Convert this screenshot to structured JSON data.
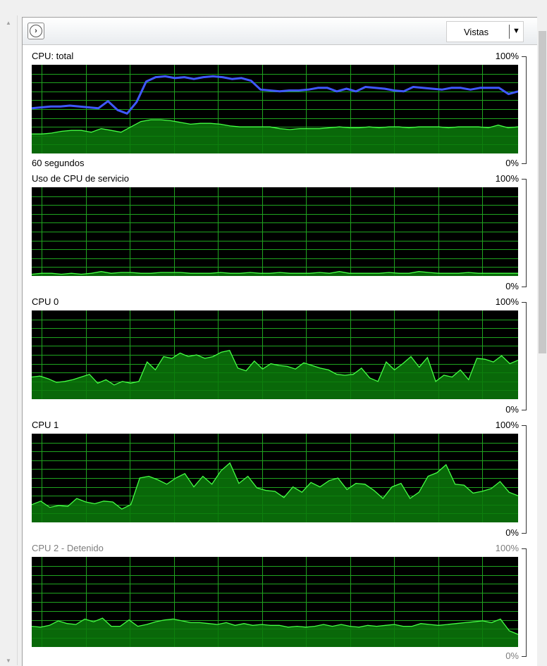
{
  "toolbar": {
    "views_label": "Vistas",
    "expand_icon": "chevron-right-icon"
  },
  "colors": {
    "grid": "#1fa31f",
    "fill": "#0a7a0a",
    "line": "#44ff44",
    "total_line": "#3f58ff",
    "background": "#000000"
  },
  "graphs": [
    {
      "id": "total",
      "title": "CPU: total",
      "max_label": "100%",
      "min_label": "0%",
      "duration_label": "60 segundos",
      "stopped": false
    },
    {
      "id": "service",
      "title": "Uso de CPU de servicio",
      "max_label": "100%",
      "min_label": "0%",
      "stopped": false
    },
    {
      "id": "cpu0",
      "title": "CPU 0",
      "max_label": "100%",
      "min_label": "0%",
      "stopped": false
    },
    {
      "id": "cpu1",
      "title": "CPU 1",
      "max_label": "100%",
      "min_label": "0%",
      "stopped": false
    },
    {
      "id": "cpu2",
      "title": "CPU 2 - Detenido",
      "max_label": "100%",
      "min_label": "0%",
      "stopped": true
    }
  ],
  "chart_data": [
    {
      "type": "area",
      "title": "CPU: total",
      "ylim": [
        0,
        100
      ],
      "series": [
        {
          "values": [
            22,
            22,
            23,
            25,
            26,
            26,
            24,
            28,
            26,
            24,
            30,
            36,
            38,
            38,
            37,
            35,
            33,
            34,
            34,
            33,
            31,
            30,
            30,
            30,
            30,
            28,
            27,
            28,
            28,
            28,
            29,
            30,
            29,
            29,
            30,
            29,
            30,
            30,
            29,
            30,
            30,
            30,
            29,
            30,
            30,
            30,
            29,
            32,
            29,
            30
          ]
        },
        {
          "values": [
            51,
            52,
            53,
            53,
            54,
            53,
            52,
            51,
            59,
            49,
            45,
            58,
            81,
            86,
            87,
            85,
            86,
            84,
            86,
            87,
            86,
            84,
            85,
            82,
            72,
            71,
            70,
            71,
            71,
            72,
            74,
            74,
            70,
            73,
            70,
            75,
            74,
            73,
            71,
            70,
            75,
            74,
            73,
            72,
            74,
            74,
            72,
            74,
            74,
            74,
            67,
            70
          ]
        }
      ],
      "grid": true
    },
    {
      "type": "area",
      "title": "Uso de CPU de servicio",
      "ylim": [
        0,
        100
      ],
      "series": [
        {
          "values": [
            2,
            3,
            3,
            2,
            3,
            2,
            3,
            5,
            3,
            4,
            4,
            3,
            3,
            4,
            4,
            4,
            3,
            3,
            3,
            4,
            3,
            3,
            4,
            3,
            3,
            4,
            3,
            3,
            3,
            4,
            3,
            5,
            3,
            3,
            3,
            3,
            4,
            3,
            3,
            5,
            4,
            3,
            3,
            3,
            4,
            3,
            3,
            3,
            3,
            3
          ]
        }
      ],
      "grid": true
    },
    {
      "type": "area",
      "title": "CPU 0",
      "ylim": [
        0,
        100
      ],
      "series": [
        {
          "values": [
            25,
            26,
            23,
            19,
            20,
            22,
            25,
            28,
            18,
            22,
            16,
            20,
            18,
            20,
            42,
            33,
            48,
            46,
            52,
            48,
            50,
            46,
            48,
            53,
            55,
            35,
            32,
            43,
            34,
            40,
            38,
            37,
            34,
            41,
            38,
            35,
            33,
            28,
            27,
            28,
            35,
            24,
            20,
            42,
            33,
            40,
            48,
            36,
            47,
            20,
            27,
            25,
            33,
            22,
            46,
            45,
            42,
            49,
            40,
            44
          ]
        }
      ],
      "grid": true
    },
    {
      "type": "area",
      "title": "CPU 1",
      "ylim": [
        0,
        100
      ],
      "series": [
        {
          "values": [
            20,
            24,
            17,
            19,
            18,
            27,
            23,
            21,
            24,
            23,
            15,
            20,
            50,
            52,
            48,
            43,
            50,
            55,
            40,
            52,
            43,
            58,
            67,
            44,
            52,
            39,
            36,
            35,
            28,
            40,
            34,
            45,
            40,
            47,
            50,
            37,
            44,
            43,
            36,
            27,
            40,
            44,
            27,
            34,
            52,
            56,
            65,
            43,
            42,
            33,
            35,
            38,
            46,
            34,
            30
          ]
        }
      ],
      "grid": true
    },
    {
      "type": "area",
      "title": "CPU 2 - Detenido",
      "ylim": [
        0,
        100
      ],
      "series": [
        {
          "values": [
            23,
            22,
            24,
            29,
            26,
            25,
            31,
            28,
            32,
            23,
            23,
            30,
            23,
            25,
            28,
            30,
            31,
            29,
            27,
            27,
            26,
            25,
            27,
            24,
            26,
            24,
            25,
            24,
            24,
            22,
            23,
            22,
            23,
            25,
            23,
            25,
            23,
            22,
            24,
            23,
            24,
            25,
            23,
            23,
            26,
            25,
            24,
            25,
            26,
            27,
            28,
            29,
            27,
            31,
            18,
            14
          ]
        }
      ],
      "grid": true
    }
  ]
}
